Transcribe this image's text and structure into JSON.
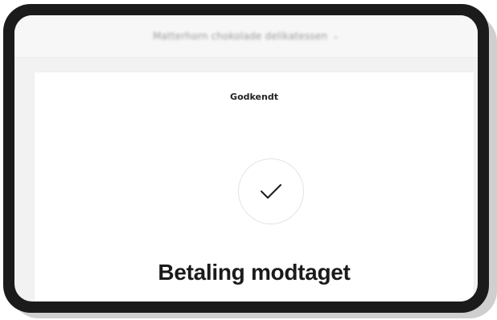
{
  "header": {
    "merchant_name": "Matterhorn chokolade delikatessen",
    "dropdown_icon": "chevron-down-icon"
  },
  "payment": {
    "status_label": "Godkendt",
    "status_icon": "checkmark-icon",
    "headline": "Betaling modtaget"
  },
  "colors": {
    "frame": "#1b1b1b",
    "background": "#f2f2f2",
    "card": "#ffffff",
    "text": "#1b1b1b"
  }
}
